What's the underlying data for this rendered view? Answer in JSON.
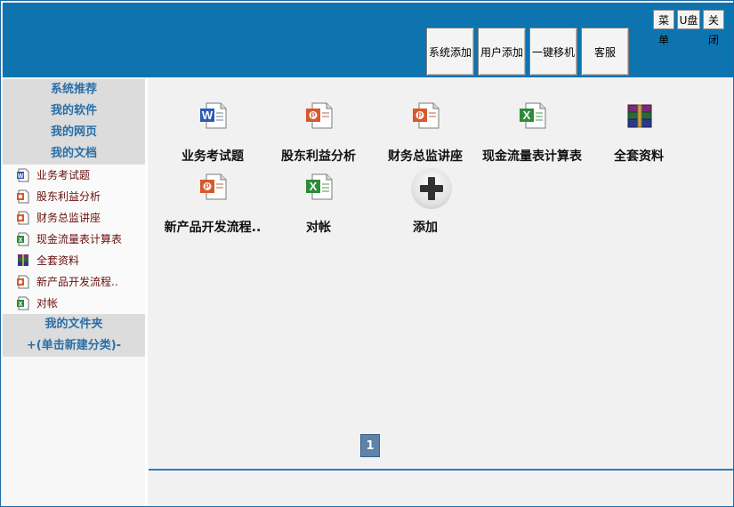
{
  "header": {
    "top_buttons": [
      "菜单",
      "U盘",
      "关闭"
    ],
    "big_buttons": [
      "系统添加",
      "用户添加",
      "一键移机",
      "客服"
    ]
  },
  "sidebar": {
    "sections": [
      "系统推荐",
      "我的软件",
      "我的网页",
      "我的文档"
    ],
    "items": [
      {
        "label": "业务考试题",
        "icon": "word-doc-icon"
      },
      {
        "label": "股东利益分析",
        "icon": "ppt-doc-icon"
      },
      {
        "label": "财务总监讲座",
        "icon": "ppt-doc-icon"
      },
      {
        "label": "现金流量表计算表",
        "icon": "excel-doc-icon"
      },
      {
        "label": "全套资料",
        "icon": "rar-archive-icon"
      },
      {
        "label": "新产品开发流程..",
        "icon": "ppt-doc-icon"
      },
      {
        "label": "对帐",
        "icon": "excel-doc-icon"
      }
    ],
    "folder_header": "我的文件夹",
    "new_category": "+(单击新建分类)-"
  },
  "main": {
    "tiles": [
      {
        "label": "业务考试题",
        "icon": "word-doc-icon"
      },
      {
        "label": "股东利益分析",
        "icon": "ppt-doc-icon"
      },
      {
        "label": "财务总监讲座",
        "icon": "ppt-doc-icon"
      },
      {
        "label": "现金流量表计算表",
        "icon": "excel-doc-icon"
      },
      {
        "label": "全套资料",
        "icon": "rar-archive-icon"
      },
      {
        "label": "新产品开发流程..",
        "icon": "ppt-doc-icon"
      },
      {
        "label": "对帐",
        "icon": "excel-doc-icon"
      },
      {
        "label": "添加",
        "icon": "add-icon"
      }
    ],
    "page": "1"
  }
}
